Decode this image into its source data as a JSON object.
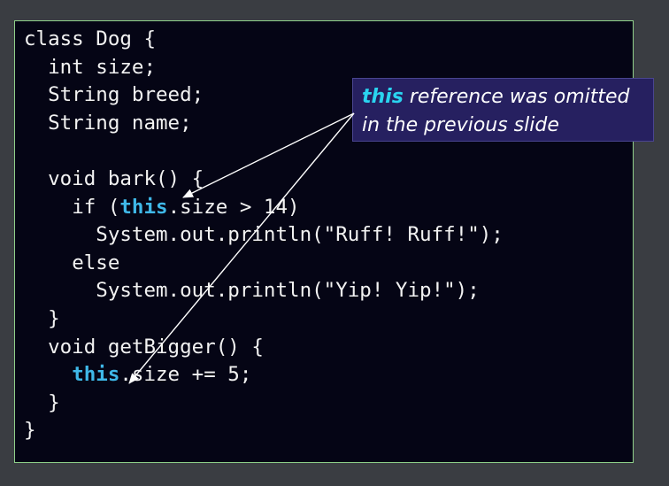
{
  "code_lines": [
    {
      "indent": "",
      "text": "class Dog {"
    },
    {
      "indent": "  ",
      "text": "int size;"
    },
    {
      "indent": "  ",
      "text": "String breed;"
    },
    {
      "indent": "  ",
      "text": "String name;"
    },
    {
      "indent": "",
      "text": ""
    },
    {
      "indent": "  ",
      "text": "void bark() {"
    },
    {
      "indent": "    ",
      "prefix": "if (",
      "keyword": "this",
      "suffix": ".size > 14)"
    },
    {
      "indent": "      ",
      "text": "System.out.println(\"Ruff! Ruff!\");"
    },
    {
      "indent": "    ",
      "text": "else"
    },
    {
      "indent": "      ",
      "text": "System.out.println(\"Yip! Yip!\");"
    },
    {
      "indent": "  ",
      "text": "}"
    },
    {
      "indent": "  ",
      "text": "void getBigger() {"
    },
    {
      "indent": "    ",
      "prefix": "",
      "keyword": "this",
      "suffix": ".size += 5;"
    },
    {
      "indent": "  ",
      "text": "}"
    },
    {
      "indent": "",
      "text": "}"
    }
  ],
  "callout": {
    "keyword": "this",
    "text_line1": " reference was omitted",
    "text_line2": "in the previous slide"
  },
  "colors": {
    "background": "#3a3d42",
    "code_background": "#050515",
    "code_border": "#8fd08a",
    "code_text": "#f2f2f2",
    "keyword": "#3fb8e8",
    "callout_background": "#262060",
    "callout_keyword": "#2ad4f0"
  }
}
